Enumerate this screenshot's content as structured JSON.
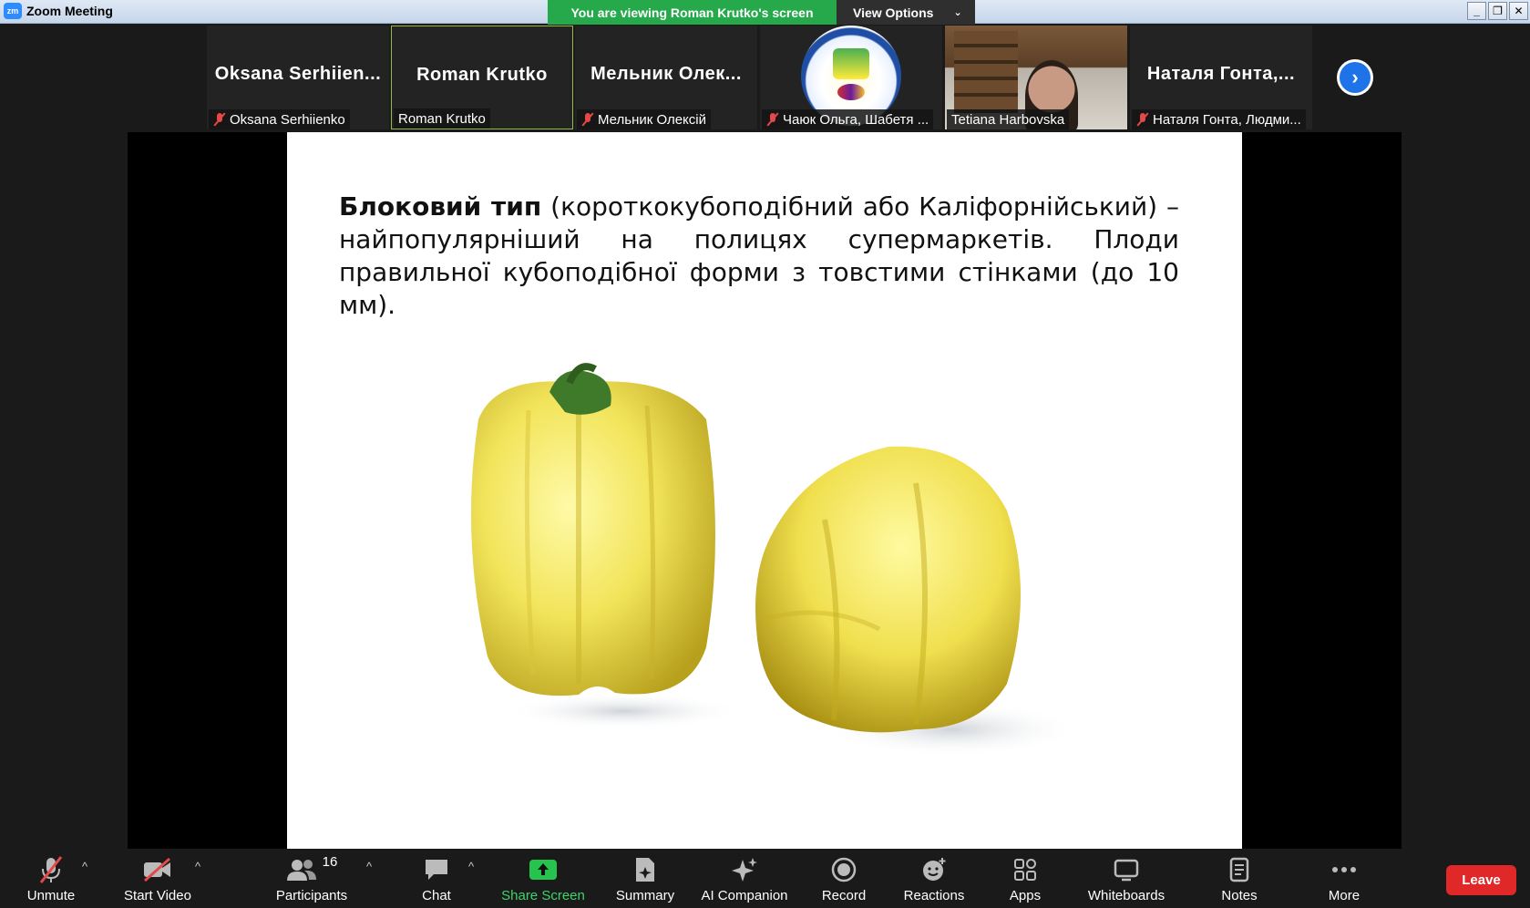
{
  "window": {
    "title": "Zoom Meeting",
    "logo_text": "zm"
  },
  "banner": {
    "viewing": "You are viewing Roman Krutko's screen",
    "view_options": "View Options"
  },
  "participants_strip": [
    {
      "big": "Oksana Serhiien...",
      "label": "Oksana Serhiienko",
      "muted": true
    },
    {
      "big": "Roman Krutko",
      "label": "Roman Krutko",
      "muted": false,
      "active": true
    },
    {
      "big": "Мельник Олек...",
      "label": "Мельник Олексій",
      "muted": true
    },
    {
      "big": "",
      "label": "Чаюк Ольга, Шабетя ...",
      "muted": true,
      "avatar": "university-logo"
    },
    {
      "big": "",
      "label": "Tetiana Harbovska",
      "muted": false,
      "video": true
    },
    {
      "big": "Наталя Гонта,...",
      "label": "Наталя Гонта, Людми...",
      "muted": true
    }
  ],
  "slide": {
    "bold_lead": "Блоковий тип",
    "text": "(короткокубоподібний або Каліфорнійський) – найпопулярніший на полицях супермаркетів. Плоди правильної кубоподібної форми з товстими стінками (до 10 мм)."
  },
  "toolbar": {
    "unmute": "Unmute",
    "start_video": "Start Video",
    "participants": "Participants",
    "participants_count": "16",
    "chat": "Chat",
    "share_screen": "Share Screen",
    "summary": "Summary",
    "ai_companion": "AI Companion",
    "record": "Record",
    "reactions": "Reactions",
    "apps": "Apps",
    "whiteboards": "Whiteboards",
    "notes": "Notes",
    "more": "More",
    "leave": "Leave"
  },
  "colors": {
    "share_green": "#26a94b",
    "leave_red": "#e02828",
    "accent_blue": "#1e73e8",
    "active_border": "#97b945"
  }
}
